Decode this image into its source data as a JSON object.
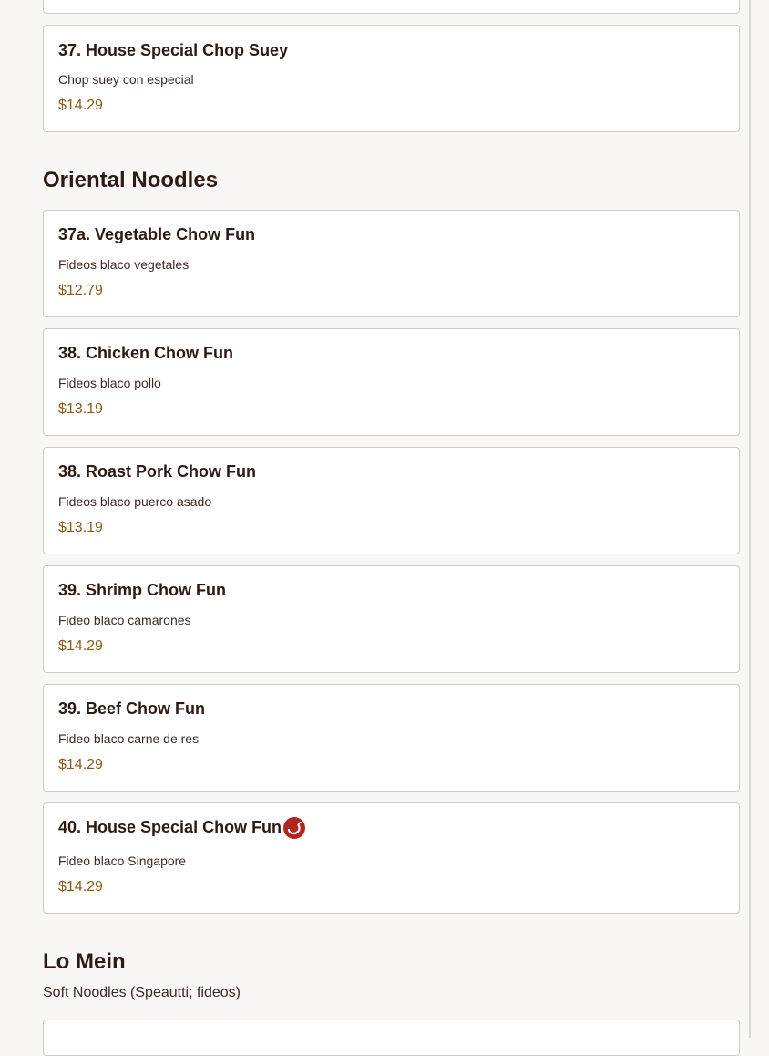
{
  "sections": [
    {
      "id": "chop-suey-tail",
      "items": [
        {
          "name": "37. House Special Chop Suey",
          "description": "Chop suey con especial",
          "price": "$14.29"
        }
      ]
    },
    {
      "id": "oriental-noodles",
      "title": "Oriental Noodles",
      "items": [
        {
          "name": "37a. Vegetable Chow Fun",
          "description": "Fideos blaco vegetales",
          "price": "$12.79"
        },
        {
          "name": "38. Chicken Chow Fun",
          "description": "Fideos blaco pollo",
          "price": "$13.19"
        },
        {
          "name": "38. Roast Pork Chow Fun",
          "description": "Fideos blaco puerco asado",
          "price": "$13.19"
        },
        {
          "name": "39. Shrimp Chow Fun",
          "description": "Fideo blaco camarones",
          "price": "$14.29"
        },
        {
          "name": "39. Beef Chow Fun",
          "description": "Fideo blaco carne de res",
          "price": "$14.29"
        },
        {
          "name": "40. House Special Chow Fun",
          "description": "Fideo blaco Singapore",
          "price": "$14.29",
          "badge_icon": "spicy-chili-icon"
        }
      ]
    },
    {
      "id": "lo-mein",
      "title": "Lo Mein",
      "subtitle": "Soft Noodles (Speautti; fideos)"
    }
  ],
  "colors": {
    "background": "#f8f7f5",
    "card_background": "#ffffff",
    "card_border": "#cfcbc8",
    "text_primary": "#2d1a14",
    "price": "#8a5a17",
    "spicy_badge": "#b3261e"
  }
}
